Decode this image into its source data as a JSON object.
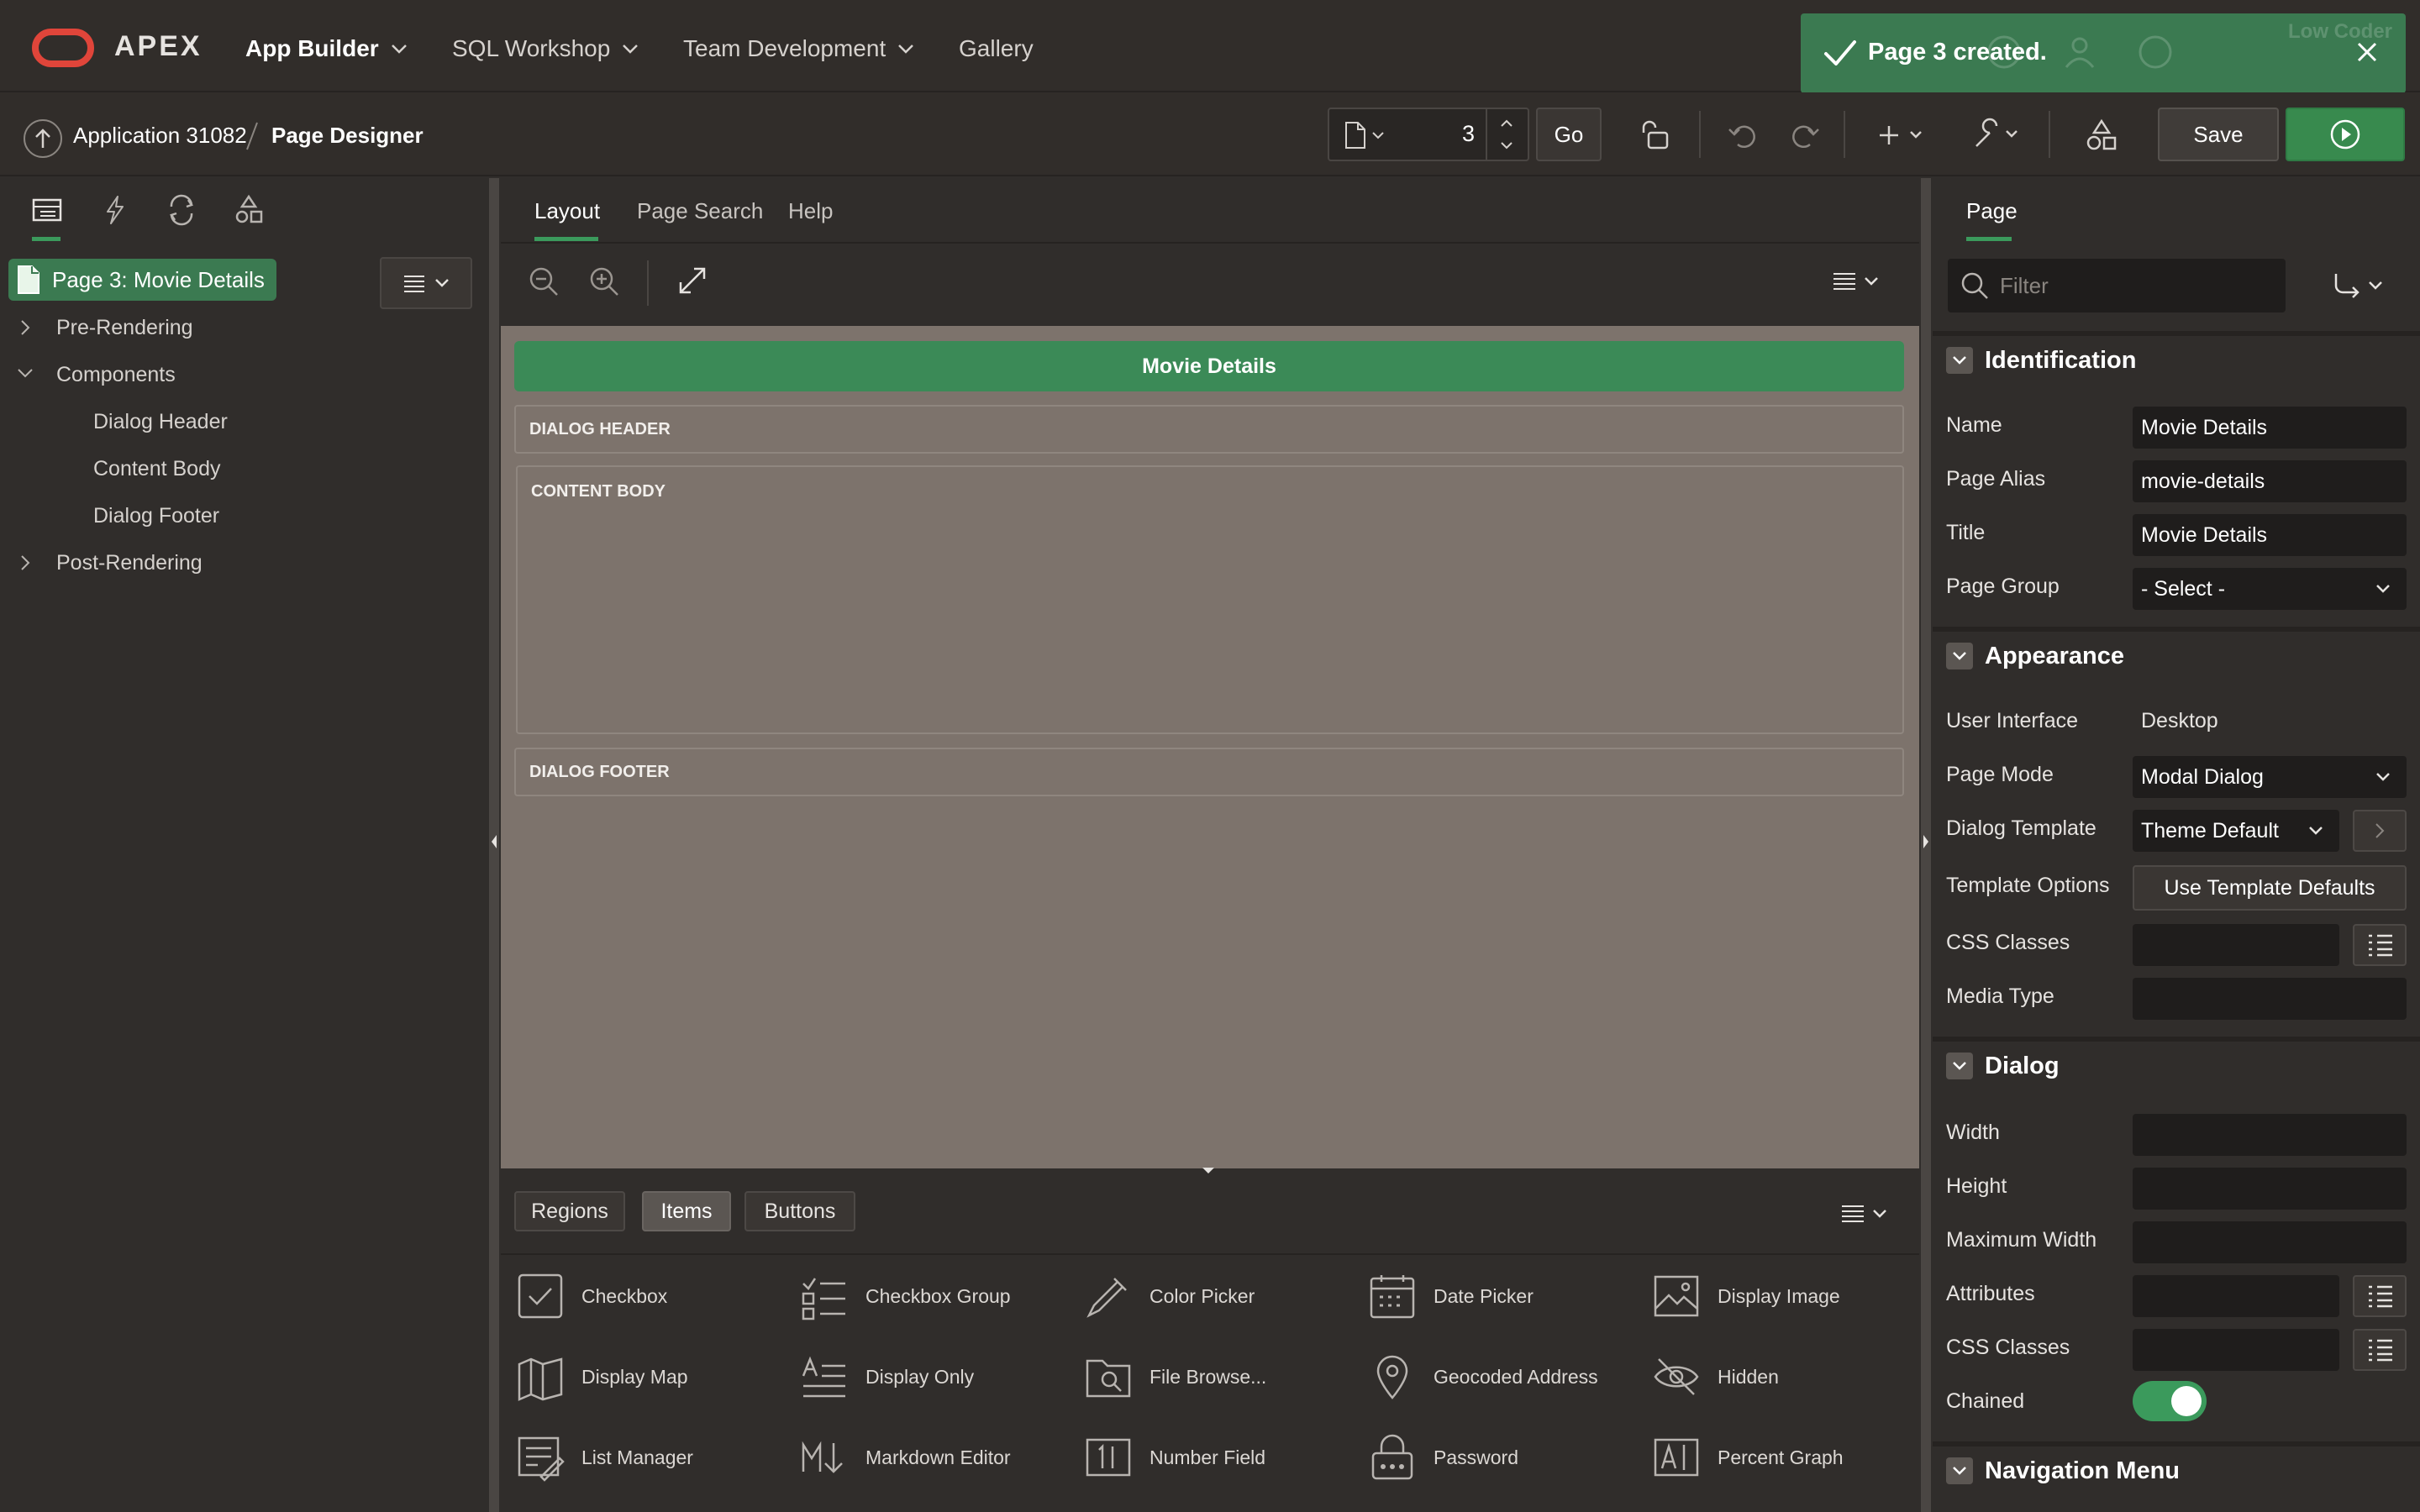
{
  "header": {
    "brand": "APEX",
    "nav": [
      "App Builder",
      "SQL Workshop",
      "Team Development",
      "Gallery"
    ],
    "toast": "Page 3 created.",
    "ghost_user": "Low Coder"
  },
  "toolbar": {
    "breadcrumb_app": "Application 31082",
    "breadcrumb_page": "Page Designer",
    "page_number": "3",
    "go_label": "Go",
    "save_label": "Save"
  },
  "left_panel": {
    "root": "Page 3: Movie Details",
    "tree": [
      "Pre-Rendering",
      "Components",
      "Dialog Header",
      "Content Body",
      "Dialog Footer",
      "Post-Rendering"
    ]
  },
  "center": {
    "tabs": [
      "Layout",
      "Page Search",
      "Help"
    ],
    "page_title": "Movie Details",
    "slots": [
      "DIALOG HEADER",
      "CONTENT BODY",
      "DIALOG FOOTER"
    ],
    "gallery_tabs": [
      "Regions",
      "Items",
      "Buttons"
    ],
    "gallery_items": [
      [
        "Checkbox",
        "Checkbox Group",
        "Color Picker",
        "Date Picker",
        "Display Image"
      ],
      [
        "Display Map",
        "Display Only",
        "File Browse...",
        "Geocoded Address",
        "Hidden"
      ],
      [
        "List Manager",
        "Markdown Editor",
        "Number Field",
        "Password",
        "Percent Graph"
      ]
    ]
  },
  "right_panel": {
    "tab": "Page",
    "filter_placeholder": "Filter",
    "identification": {
      "title": "Identification",
      "name_label": "Name",
      "name_value": "Movie Details",
      "alias_label": "Page Alias",
      "alias_value": "movie-details",
      "title_label": "Title",
      "title_value": "Movie Details",
      "group_label": "Page Group",
      "group_value": "- Select -"
    },
    "appearance": {
      "title": "Appearance",
      "ui_label": "User Interface",
      "ui_value": "Desktop",
      "mode_label": "Page Mode",
      "mode_value": "Modal Dialog",
      "template_label": "Dialog Template",
      "template_value": "Theme Default",
      "options_label": "Template Options",
      "options_button": "Use Template Defaults",
      "css_label": "CSS Classes",
      "media_label": "Media Type"
    },
    "dialog": {
      "title": "Dialog",
      "width_label": "Width",
      "height_label": "Height",
      "maxwidth_label": "Maximum Width",
      "attributes_label": "Attributes",
      "css_label": "CSS Classes",
      "chained_label": "Chained",
      "chained": true
    },
    "navigation": {
      "title": "Navigation Menu"
    }
  }
}
